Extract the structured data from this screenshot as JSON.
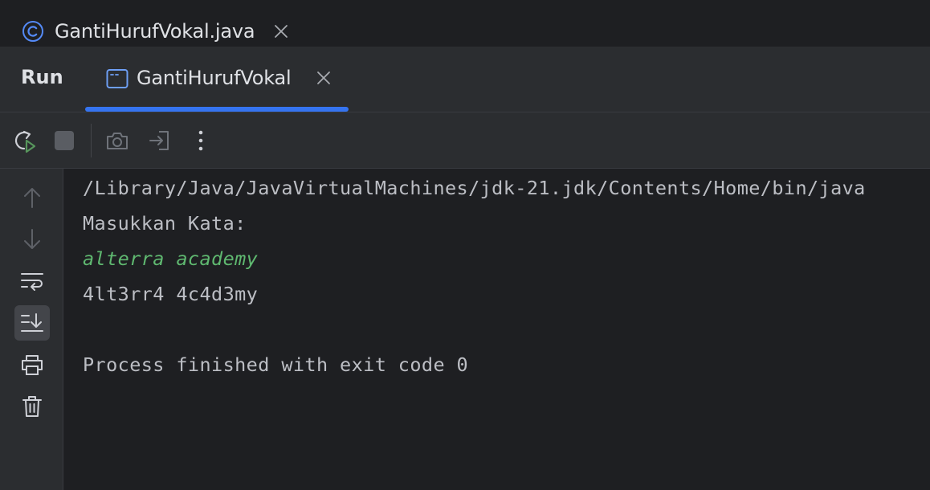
{
  "editor": {
    "tab": {
      "filename": "GantiHurufVokal.java",
      "icon": "class-c-icon"
    }
  },
  "run_panel": {
    "title": "Run",
    "tab": {
      "label": "GantiHurufVokal",
      "icon": "console-icon"
    },
    "toolbar": [
      "rerun-icon",
      "stop-icon",
      "camera-icon",
      "login-icon",
      "more-vertical-icon"
    ],
    "gutter": [
      "arrow-up-icon",
      "arrow-down-icon",
      "soft-wrap-icon",
      "scroll-to-end-icon",
      "print-icon",
      "trash-icon"
    ]
  },
  "console": {
    "lines": [
      "/Library/Java/JavaVirtualMachines/jdk-21.jdk/Contents/Home/bin/java",
      "Masukkan Kata:",
      "alterra academy",
      "4lt3rr4 4c4d3my",
      "",
      "Process finished with exit code 0"
    ]
  },
  "colors": {
    "accent": "#3574f0",
    "input_text": "#5fb870",
    "class_icon": "#548af7",
    "run_green": "#57965c"
  }
}
